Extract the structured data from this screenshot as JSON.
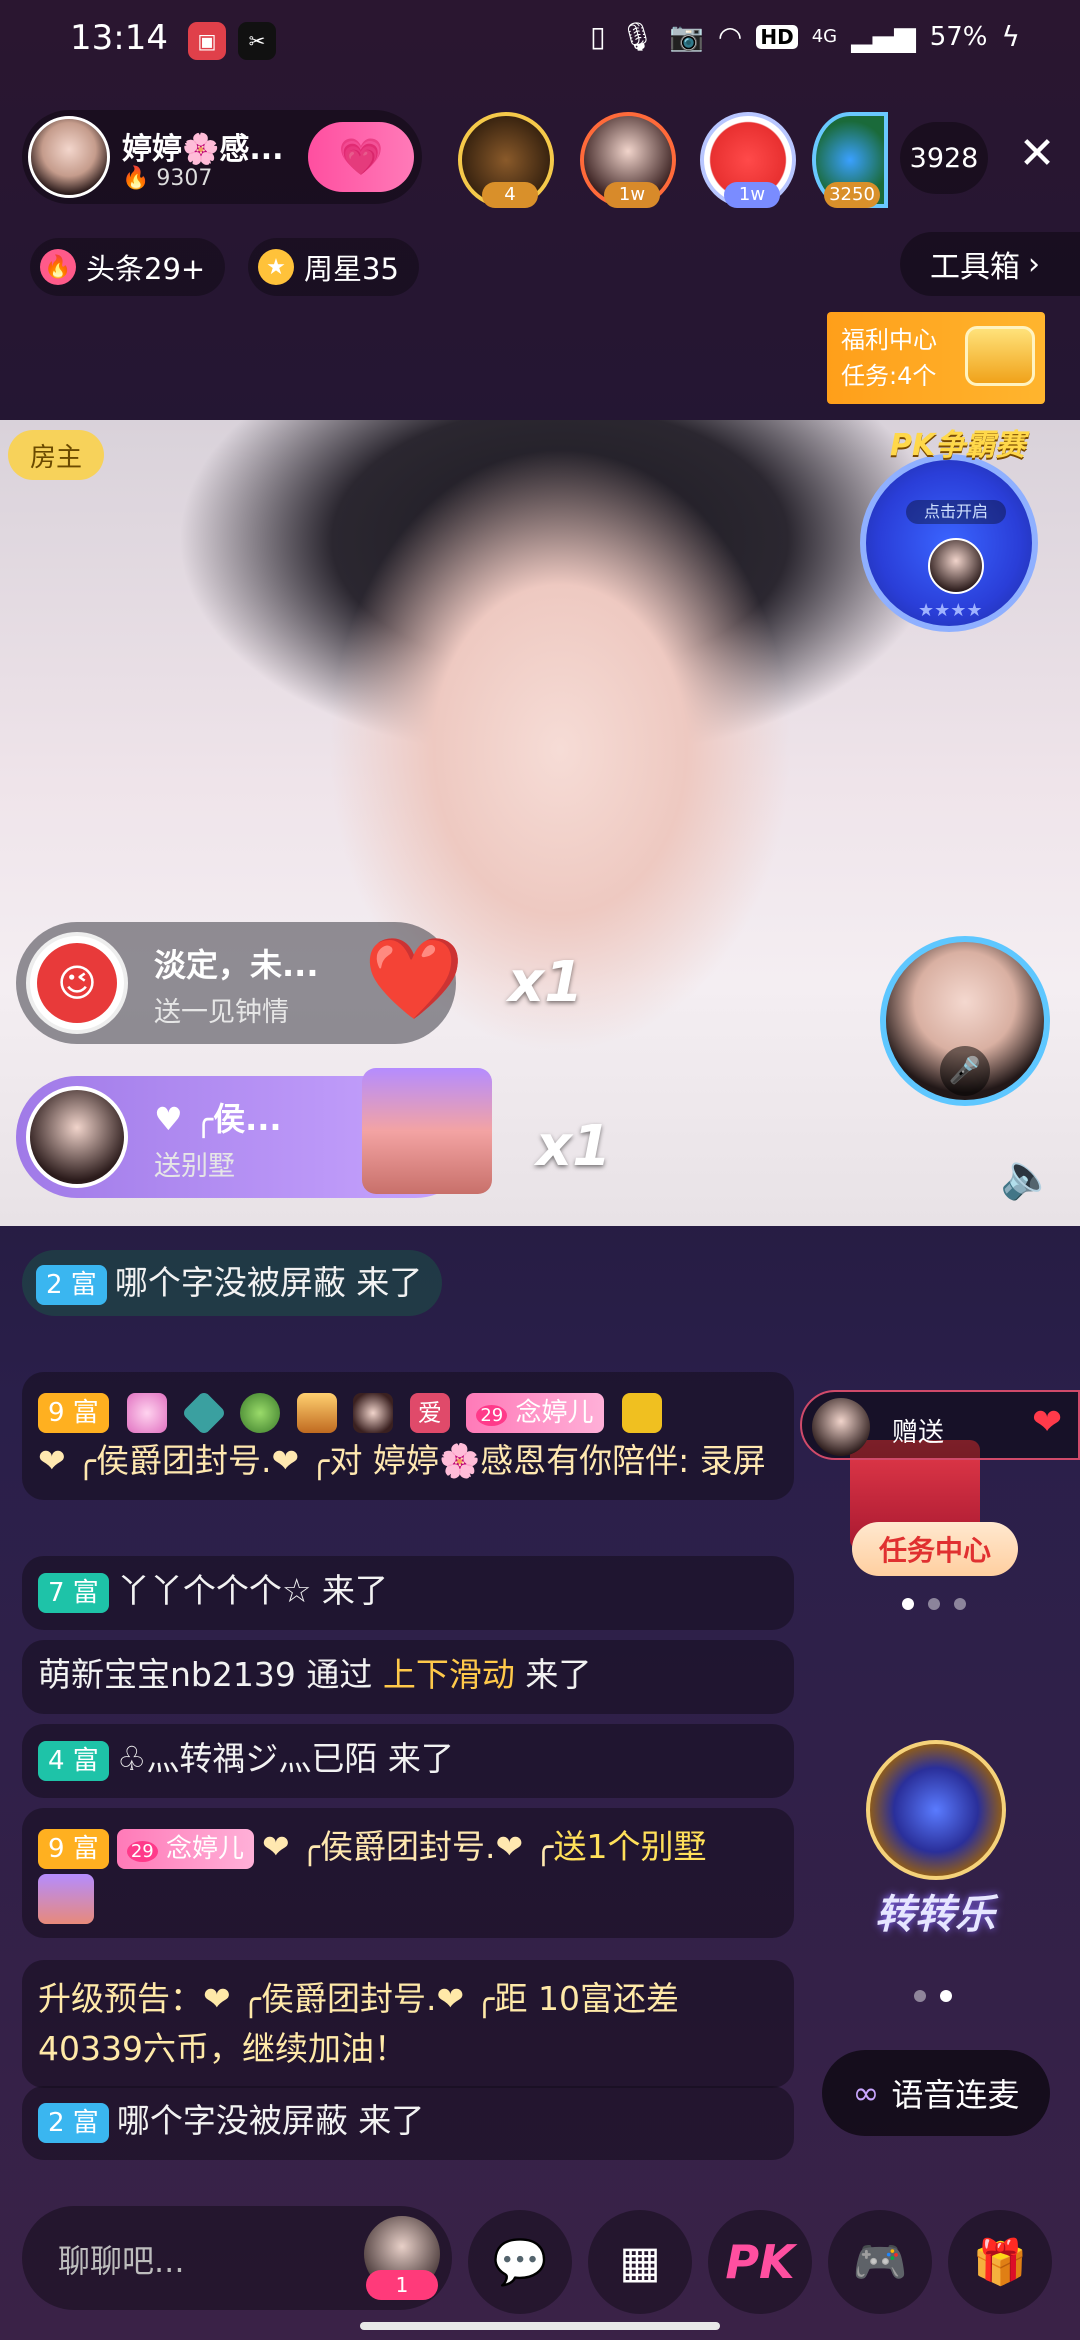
{
  "status_bar": {
    "time": "13:14",
    "battery": "57%",
    "network": "4G",
    "hd": "HD",
    "icons": [
      "video-record-icon",
      "capcut-icon",
      "vibrate-icon",
      "mic-icon",
      "camera-icon",
      "wifi-icon",
      "hd-icon",
      "signal-icon",
      "charging-icon"
    ]
  },
  "host": {
    "name": "婷婷🌸感...",
    "fans": "9307",
    "follow_icon": "heart-plus-icon"
  },
  "viewers": {
    "tags": [
      "4",
      "1w",
      "1w",
      "3250"
    ],
    "count": "3928"
  },
  "chips": {
    "headline": "头条29+",
    "weekly_star": "周星35",
    "toolbox": "工具箱"
  },
  "welfare": {
    "line1": "福利中心",
    "line2": "任务:4个"
  },
  "video": {
    "room_owner": "房主",
    "pk_title": "PK争霸赛",
    "pk_subtitle": "点击开启",
    "pk_stars": "★★★★"
  },
  "gifts": [
    {
      "sender": "淡定，未...",
      "gift": "送一见钟情",
      "multiplier": "x1"
    },
    {
      "sender": "♥ ╭侯...",
      "gift": "送别墅",
      "multiplier": "x1"
    }
  ],
  "chat": {
    "join_top": {
      "level": "2 富",
      "text": "哪个字没被屏蔽 来了"
    },
    "msg1": {
      "level": "9 富",
      "badge_text": "29",
      "badge_name": "念婷儿",
      "love_badge": "爱",
      "line": "❤ ╭侯爵团封号.❤ ╭对 婷婷🌸感恩有你陪伴: 录屏"
    },
    "msg2": {
      "level": "7 富",
      "text": "丫丫个个个☆ 来了"
    },
    "msg3": {
      "prefix": "萌新宝宝nb2139 通过 ",
      "action": "上下滑动",
      "suffix": " 来了"
    },
    "msg4": {
      "level": "4 富",
      "text": "♧灬转禑ジ灬已陌 来了"
    },
    "msg5": {
      "level": "9 富",
      "badge_text": "29",
      "badge_name": "念婷儿",
      "user": "❤ ╭侯爵团封号.❤ ╭",
      "gift": "送1个别墅"
    },
    "msg6": {
      "text": "升级预告：❤ ╭侯爵团封号.❤ ╭距 10富还差40339六币，继续加油！"
    },
    "msg7": {
      "level": "2 富",
      "text": "哪个字没被屏蔽 来了"
    }
  },
  "side": {
    "gift_label": "赠送",
    "task_center": "任务中心",
    "wheel_label": "转转乐",
    "voice_link": "语音连麦"
  },
  "bottom": {
    "chat_placeholder": "聊聊吧...",
    "avatar_badge": "1",
    "pk_label": "PK"
  }
}
